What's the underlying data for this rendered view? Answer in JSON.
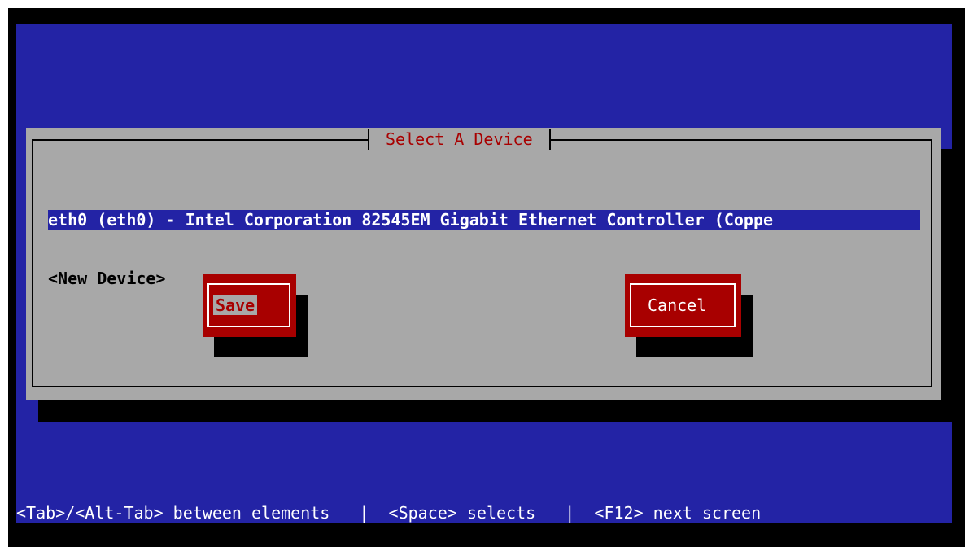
{
  "dialog": {
    "title": "Select A Device",
    "devices": [
      "eth0 (eth0) - Intel Corporation 82545EM Gigabit Ethernet Controller (Coppe",
      "<New Device>"
    ]
  },
  "buttons": {
    "save_label": "Save",
    "cancel_label": "Cancel"
  },
  "statusbar": {
    "text": "<Tab>/<Alt-Tab> between elements   |  <Space> selects   |  <F12> next screen"
  },
  "colors": {
    "backdrop": "#2323a5",
    "dialog": "#a8a8a8",
    "accent": "#a80000",
    "selection": "#2323a5"
  }
}
